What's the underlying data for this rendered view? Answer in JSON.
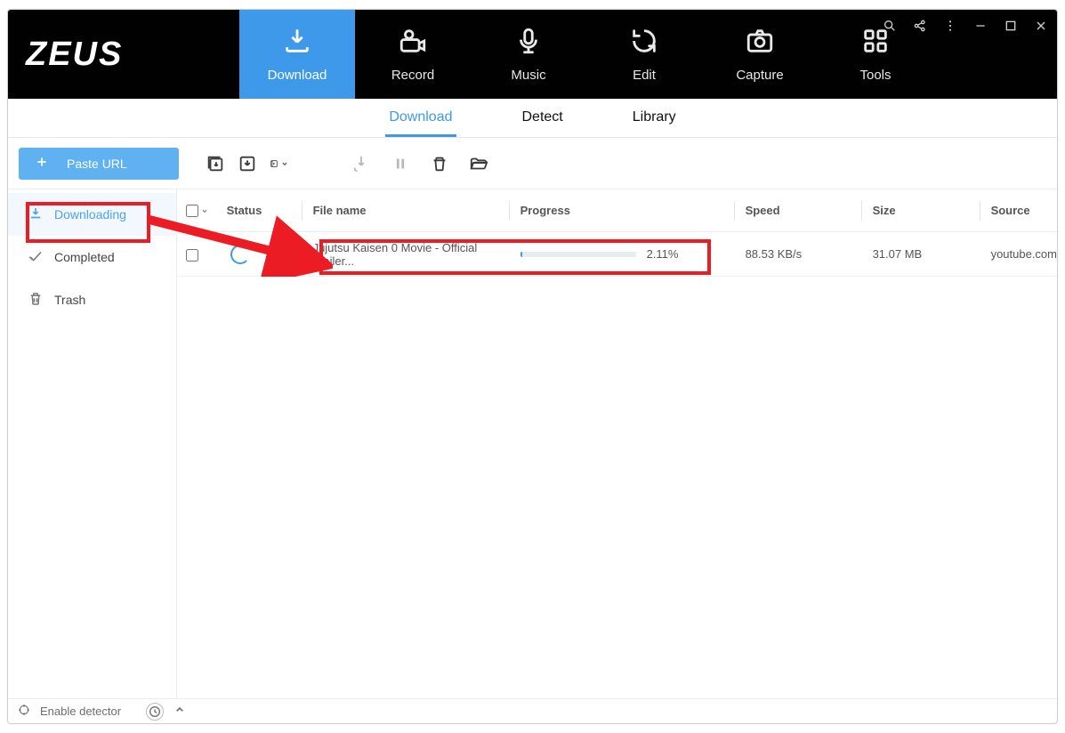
{
  "app": {
    "name": "ZEUS"
  },
  "main_tabs": [
    {
      "id": "download",
      "label": "Download",
      "active": true
    },
    {
      "id": "record",
      "label": "Record",
      "active": false
    },
    {
      "id": "music",
      "label": "Music",
      "active": false
    },
    {
      "id": "edit",
      "label": "Edit",
      "active": false
    },
    {
      "id": "capture",
      "label": "Capture",
      "active": false
    },
    {
      "id": "tools",
      "label": "Tools",
      "active": false
    }
  ],
  "sub_tabs": [
    {
      "id": "download",
      "label": "Download",
      "active": true
    },
    {
      "id": "detect",
      "label": "Detect",
      "active": false
    },
    {
      "id": "library",
      "label": "Library",
      "active": false
    }
  ],
  "toolbar": {
    "paste_url_label": "Paste URL"
  },
  "sidebar": [
    {
      "id": "downloading",
      "label": "Downloading",
      "active": true
    },
    {
      "id": "completed",
      "label": "Completed",
      "active": false
    },
    {
      "id": "trash",
      "label": "Trash",
      "active": false
    }
  ],
  "columns": {
    "status": "Status",
    "filename": "File name",
    "progress": "Progress",
    "speed": "Speed",
    "size": "Size",
    "source": "Source"
  },
  "rows": [
    {
      "selected": false,
      "status": "downloading",
      "filename": "Jujutsu Kaisen 0 Movie - Official Trailer...",
      "progress_text": "2.11%",
      "progress_value": 2.11,
      "speed": "88.53 KB/s",
      "size": "31.07 MB",
      "source": "youtube.com"
    }
  ],
  "statusbar": {
    "enable_detector": "Enable detector"
  },
  "colors": {
    "accent": "#3f99ea",
    "annotation": "#eb1c24",
    "titlebar": "#010101"
  }
}
